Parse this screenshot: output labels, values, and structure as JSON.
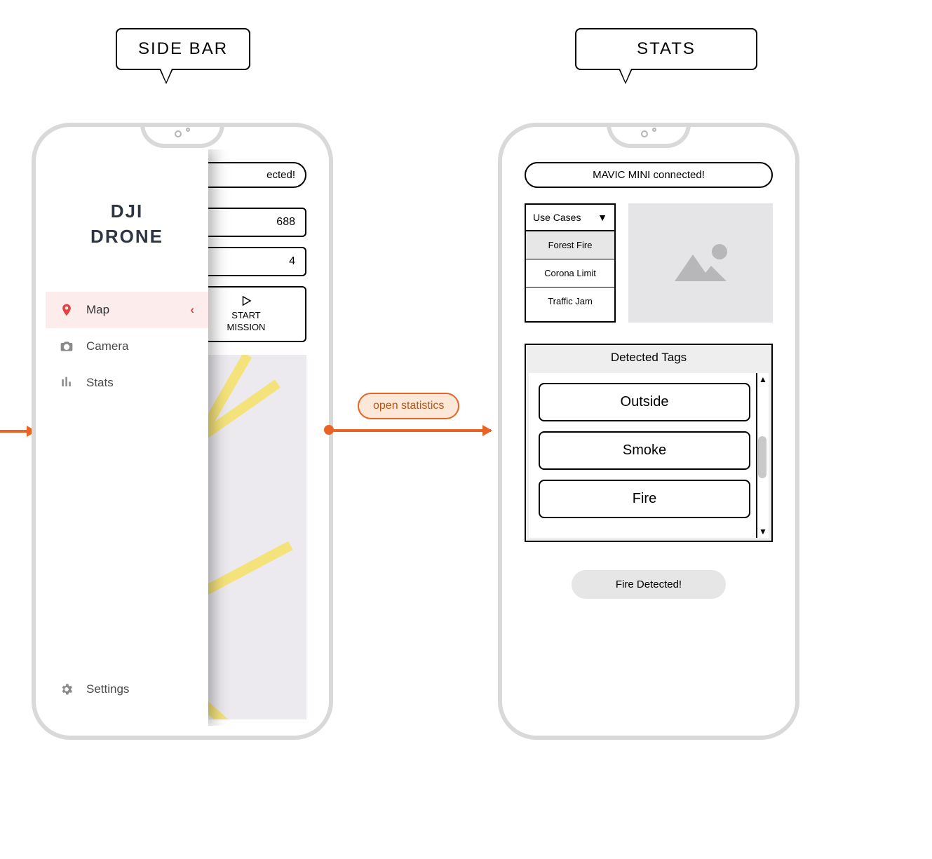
{
  "labels": {
    "sidebar_bubble": "SIDE BAR",
    "stats_bubble": "STATS",
    "flow_label": "open statistics"
  },
  "left": {
    "brand_line1": "DJI",
    "brand_line2": "DRONE",
    "status_visible": "ected!",
    "coord1_visible": "688",
    "coord2_visible": "4",
    "start_mission": "START\nMISSION",
    "nav": {
      "map": "Map",
      "camera": "Camera",
      "stats": "Stats",
      "settings": "Settings"
    }
  },
  "right": {
    "status": "MAVIC MINI connected!",
    "usecases": {
      "header": "Use Cases",
      "options": [
        "Forest Fire",
        "Corona Limit",
        "Traffic Jam"
      ],
      "selected_index": 0
    },
    "detected": {
      "title": "Detected Tags",
      "tags": [
        "Outside",
        "Smoke",
        "Fire"
      ]
    },
    "alert": "Fire Detected!"
  }
}
